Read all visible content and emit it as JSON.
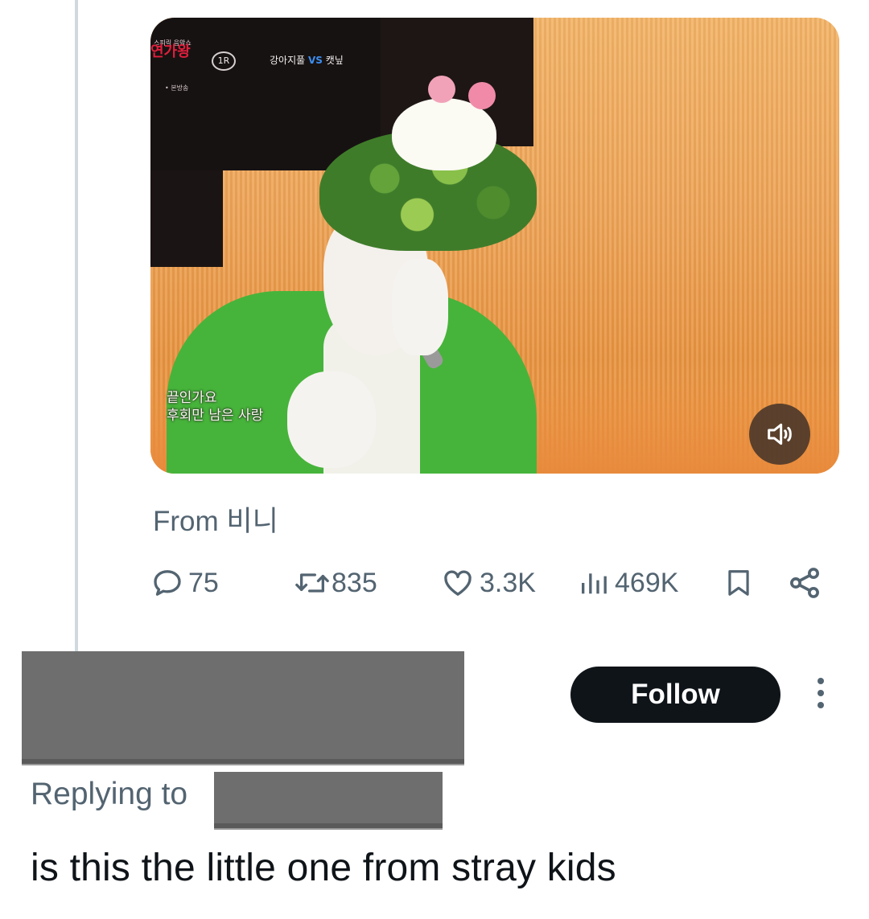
{
  "media": {
    "broadcast_logo": "연가왕",
    "broadcast_logo_sub": "스피릭 음악쇼",
    "on_air_tag": "• 본방송",
    "round": "1R",
    "contestant_a": "강아지풀",
    "vs": "VS",
    "contestant_b": "캣닢",
    "subtitle_line1": "끝인가요",
    "subtitle_line2": "후회만 남은 사랑",
    "icons": {
      "mute": "speaker-volume-icon"
    }
  },
  "attribution": {
    "text": "From 비니"
  },
  "actions": {
    "replies": "75",
    "reposts": "835",
    "likes": "3.3K",
    "views": "469K",
    "icons": [
      "reply-icon",
      "repost-icon",
      "like-icon",
      "views-icon",
      "bookmark-icon",
      "share-icon"
    ]
  },
  "author": {
    "follow_label": "Follow"
  },
  "reply": {
    "replying_to_label": "Replying to",
    "text": "is this the little one from stray kids"
  },
  "colors": {
    "text_primary": "#0f1419",
    "text_secondary": "#536471",
    "thread_line": "#cfd9de",
    "follow_bg": "#0f1419",
    "redaction": "#6e6e6e"
  }
}
